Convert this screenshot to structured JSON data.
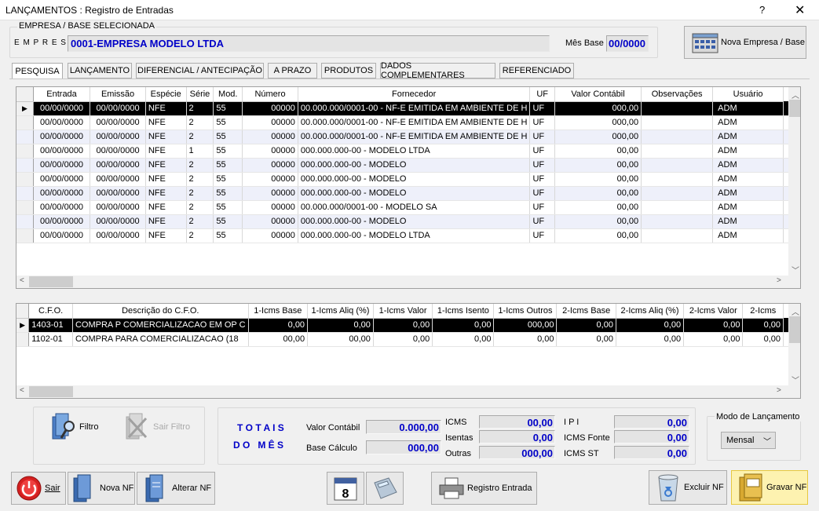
{
  "window": {
    "title": "LANÇAMENTOS : Registro de Entradas",
    "help": "?",
    "close": "✕"
  },
  "empresa": {
    "group_label": "EMPRESA  /  BASE  SELECIONADA",
    "label": "E M P R E S A",
    "value": "0001-EMPRESA MODELO LTDA",
    "mes_base_label": "Mês Base",
    "mes_base_value": "00/0000",
    "nova_empresa_label": "Nova Empresa / Base"
  },
  "tabs": [
    {
      "label": "PESQUISA",
      "active": true
    },
    {
      "label": "LANÇAMENTO"
    },
    {
      "label": "DIFERENCIAL / ANTECIPAÇÃO"
    },
    {
      "label": "A PRAZO"
    },
    {
      "label": "PRODUTOS"
    },
    {
      "label": "DADOS COMPLEMENTARES"
    },
    {
      "label": "REFERENCIADO"
    }
  ],
  "entries": {
    "columns": [
      "Entrada",
      "Emissão",
      "Espécie",
      "Série",
      "Mod.",
      "Número",
      "Fornecedor",
      "UF",
      "Valor Contábil",
      "Observações",
      "Usuário"
    ],
    "rows": [
      [
        "00/00/0000",
        "00/00/0000",
        "NFE",
        "2",
        "55",
        "00000",
        "00.000.000/0001-00 - NF-E EMITIDA EM AMBIENTE DE H",
        "UF",
        "000,00",
        "",
        "ADM"
      ],
      [
        "00/00/0000",
        "00/00/0000",
        "NFE",
        "2",
        "55",
        "00000",
        "00.000.000/0001-00 - NF-E EMITIDA EM AMBIENTE DE H",
        "UF",
        "000,00",
        "",
        "ADM"
      ],
      [
        "00/00/0000",
        "00/00/0000",
        "NFE",
        "2",
        "55",
        "00000",
        "00.000.000/0001-00 - NF-E EMITIDA EM AMBIENTE DE H",
        "UF",
        "000,00",
        "",
        "ADM"
      ],
      [
        "00/00/0000",
        "00/00/0000",
        "NFE",
        "1",
        "55",
        "00000",
        "000.000.000-00     - MODELO LTDA",
        "UF",
        "00,00",
        "",
        "ADM"
      ],
      [
        "00/00/0000",
        "00/00/0000",
        "NFE",
        "2",
        "55",
        "00000",
        "000.000.000-00     - MODELO",
        "UF",
        "00,00",
        "",
        "ADM"
      ],
      [
        "00/00/0000",
        "00/00/0000",
        "NFE",
        "2",
        "55",
        "00000",
        "000.000.000-00     - MODELO",
        "UF",
        "00,00",
        "",
        "ADM"
      ],
      [
        "00/00/0000",
        "00/00/0000",
        "NFE",
        "2",
        "55",
        "00000",
        "000.000.000-00     - MODELO",
        "UF",
        "00,00",
        "",
        "ADM"
      ],
      [
        "00/00/0000",
        "00/00/0000",
        "NFE",
        "2",
        "55",
        "00000",
        "00.000.000/0001-00 - MODELO SA",
        "UF",
        "00,00",
        "",
        "ADM"
      ],
      [
        "00/00/0000",
        "00/00/0000",
        "NFE",
        "2",
        "55",
        "00000",
        "000.000.000-00     - MODELO",
        "UF",
        "00,00",
        "",
        "ADM"
      ],
      [
        "00/00/0000",
        "00/00/0000",
        "NFE",
        "2",
        "55",
        "00000",
        "000.000.000-00     - MODELO LTDA",
        "UF",
        "00,00",
        "",
        "ADM"
      ]
    ]
  },
  "cfo": {
    "columns": [
      "C.F.O.",
      "Descrição do C.F.O.",
      "1-Icms Base",
      "1-Icms Aliq (%)",
      "1-Icms Valor",
      "1-Icms Isento",
      "1-Icms Outros",
      "2-Icms Base",
      "2-Icms Aliq (%)",
      "2-Icms Valor",
      "2-Icms"
    ],
    "rows": [
      [
        "1403-01",
        "COMPRA P COMERCIALIZACAO EM OP C",
        "0,00",
        "0,00",
        "0,00",
        "0,00",
        "000,00",
        "0,00",
        "0,00",
        "0,00",
        "0,00"
      ],
      [
        "1102-01",
        "COMPRA PARA COMERCIALIZACAO (18",
        "00,00",
        "00,00",
        "0,00",
        "0,00",
        "0,00",
        "0,00",
        "0,00",
        "0,00",
        "0,00"
      ]
    ]
  },
  "filtro": {
    "filtro_label": "Filtro",
    "sair_filtro_label": "Sair Filtro"
  },
  "totais": {
    "title_1": "T O T A I S",
    "title_2": "D O   M Ê S",
    "valor_contabil_label": "Valor Contábil",
    "valor_contabil": "0.000,00",
    "base_calculo_label": "Base Cálculo",
    "base_calculo": "000,00",
    "icms_label": "ICMS",
    "icms": "00,00",
    "isentas_label": "Isentas",
    "isentas": "0,00",
    "outras_label": "Outras",
    "outras": "000,00",
    "ipi_label": "I P I",
    "ipi": "0,00",
    "icms_fonte_label": "ICMS Fonte",
    "icms_fonte": "0,00",
    "icms_st_label": "ICMS ST",
    "icms_st": "0,00"
  },
  "modo": {
    "label": "Modo de Lançamento",
    "value": "Mensal"
  },
  "calendar_day": "8",
  "buttons": {
    "sair": "Sair",
    "nova_nf": "Nova NF",
    "alterar_nf": "Alterar NF",
    "registro_entrada": "Registro Entrada",
    "excluir_nf": "Excluir NF",
    "gravar_nf": "Gravar NF"
  }
}
